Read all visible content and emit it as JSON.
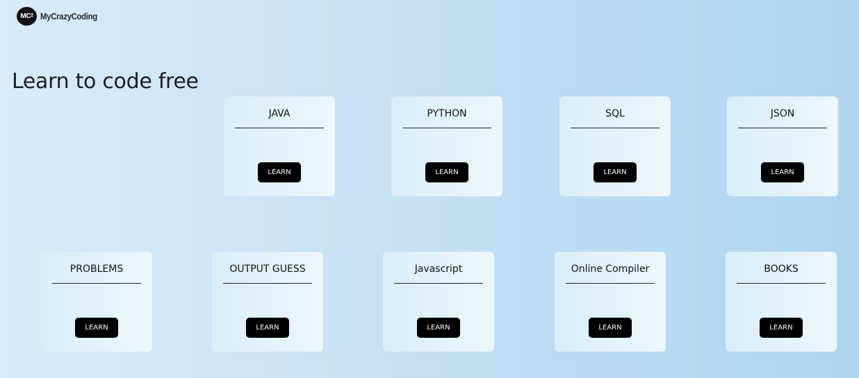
{
  "header": {
    "logo_badge": "MC",
    "logo_badge_sup": "2",
    "logo_text": "MyCrazyCoding"
  },
  "hero": {
    "title": "Learn to code free"
  },
  "cards": [
    {
      "title": "JAVA",
      "button": "LEARN"
    },
    {
      "title": "PYTHON",
      "button": "LEARN"
    },
    {
      "title": "SQL",
      "button": "LEARN"
    },
    {
      "title": "JSON",
      "button": "LEARN"
    },
    {
      "title": "PROBLEMS",
      "button": "LEARN"
    },
    {
      "title": "OUTPUT GUESS",
      "button": "LEARN"
    },
    {
      "title": "Javascript",
      "button": "LEARN"
    },
    {
      "title": "Online Compiler",
      "button": "LEARN"
    },
    {
      "title": "BOOKS",
      "button": "LEARN"
    }
  ]
}
